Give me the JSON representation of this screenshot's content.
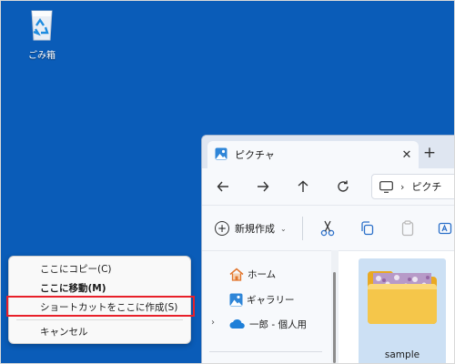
{
  "desktop": {
    "recycle_bin_label": "ごみ箱"
  },
  "explorer": {
    "tab_title": "ピクチャ",
    "address_path": "ピクチ",
    "toolbar": {
      "new_label": "新規作成"
    },
    "sidebar": {
      "items": [
        {
          "label": "ホーム",
          "icon": "home-icon"
        },
        {
          "label": "ギャラリー",
          "icon": "gallery-icon"
        },
        {
          "label": "一郎 - 個人用",
          "icon": "onedrive-cloud-icon"
        }
      ]
    },
    "files": [
      {
        "name": "sample",
        "icon": "folder-icon"
      }
    ]
  },
  "context_menu": {
    "items": [
      {
        "label": "ここにコピー(C)",
        "bold": false,
        "highlighted": false
      },
      {
        "label": "ここに移動(M)",
        "bold": true,
        "highlighted": false
      },
      {
        "label": "ショートカットをここに作成(S)",
        "bold": false,
        "highlighted": true
      },
      {
        "label": "キャンセル",
        "bold": false,
        "highlighted": false
      }
    ]
  },
  "colors": {
    "desktop_bg": "#0a5cb8",
    "highlight_box": "#e8202a",
    "folder": "#f5c64a",
    "selection": "#cce0f4"
  }
}
